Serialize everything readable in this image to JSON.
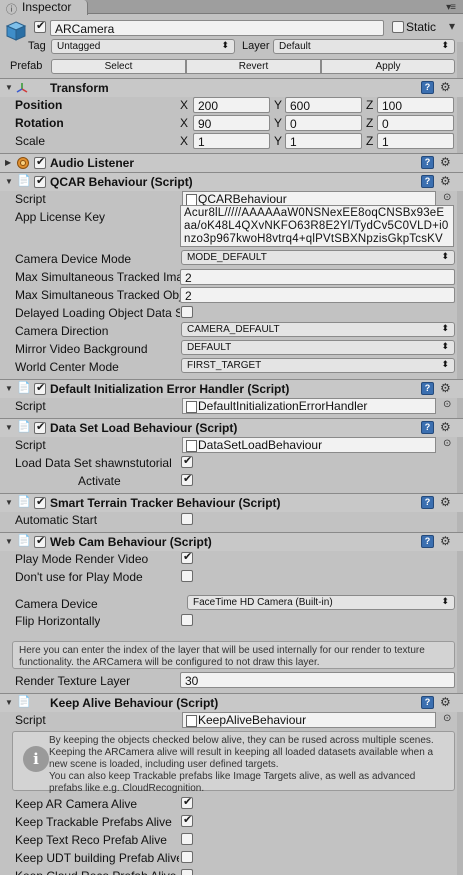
{
  "tab": {
    "label": "Inspector"
  },
  "header": {
    "object_name": "ARCamera",
    "static_label": "Static",
    "tag_label": "Tag",
    "tag_value": "Untagged",
    "layer_label": "Layer",
    "layer_value": "Default",
    "prefab_label": "Prefab",
    "select_label": "Select",
    "revert_label": "Revert",
    "apply_label": "Apply"
  },
  "transform": {
    "title": "Transform",
    "position_label": "Position",
    "rotation_label": "Rotation",
    "scale_label": "Scale",
    "axis_x": "X",
    "axis_y": "Y",
    "axis_z": "Z",
    "position": {
      "x": "200",
      "y": "600",
      "z": "100"
    },
    "rotation": {
      "x": "90",
      "y": "0",
      "z": "0"
    },
    "scale": {
      "x": "1",
      "y": "1",
      "z": "1"
    }
  },
  "audio": {
    "title": "Audio Listener"
  },
  "qcar": {
    "title": "QCAR Behaviour (Script)",
    "script_label": "Script",
    "script_value": "QCARBehaviour",
    "license_label": "App License Key",
    "license_value": "Acur8lL/////AAAAAaW0NSNexEE8oqCNSBx93eEaa/oK48L4QXvNKFO63R8E2Yl/TydCv5C0VLD+i0nzo3p967kwoH8vtrq4+qlPVtSBXNpzisGkpTcsKVRT",
    "camera_device_mode_label": "Camera Device Mode",
    "camera_device_mode_value": "MODE_DEFAULT",
    "max_images_label": "Max Simultaneous Tracked Ima",
    "max_images_value": "2",
    "max_objects_label": "Max Simultaneous Tracked Obj",
    "max_objects_value": "2",
    "delayed_label": "Delayed Loading Object Data Se",
    "camera_direction_label": "Camera Direction",
    "camera_direction_value": "CAMERA_DEFAULT",
    "mirror_label": "Mirror Video Background",
    "mirror_value": "DEFAULT",
    "world_center_label": "World Center Mode",
    "world_center_value": "FIRST_TARGET"
  },
  "init_error": {
    "title": "Default Initialization Error Handler (Script)",
    "script_label": "Script",
    "script_value": "DefaultInitializationErrorHandler"
  },
  "dataset": {
    "title": "Data Set Load Behaviour (Script)",
    "script_label": "Script",
    "script_value": "DataSetLoadBehaviour",
    "load_label": "Load Data Set shawnstutorial",
    "activate_label": "Activate"
  },
  "smart_terrain": {
    "title": "Smart Terrain Tracker Behaviour (Script)",
    "auto_start_label": "Automatic Start"
  },
  "webcam": {
    "title": "Web Cam Behaviour (Script)",
    "play_mode_label": "Play Mode Render Video",
    "dont_use_label": "Don't use for Play Mode",
    "camera_device_label": "Camera Device",
    "camera_device_value": "FaceTime HD Camera (Built-in)",
    "flip_label": "Flip Horizontally",
    "info_text": "Here you can enter the index of the layer that will be used internally for our render to texture functionality. the ARCamera will be configured to not draw this layer.",
    "render_layer_label": "Render Texture Layer",
    "render_layer_value": "30"
  },
  "keepalive": {
    "title": "Keep Alive Behaviour (Script)",
    "script_label": "Script",
    "script_value": "KeepAliveBehaviour",
    "info_line1": "By keeping the objects checked below alive, they can be rused across multiple scenes.",
    "info_line2": "Keeping the ARCamera alive will result in keeping all loaded datasets available when a new scene is loaded, including user defined targets.",
    "info_line3": "You can also keep Trackable prefabs like Image Targets alive, as well as advanced prefabs like e.g. CloudRecognition.",
    "keep_ar_label": "Keep AR Camera Alive",
    "keep_trackable_label": "Keep Trackable Prefabs Alive",
    "keep_text_label": "Keep Text Reco Prefab Alive",
    "keep_udt_label": "Keep UDT building Prefab Alive",
    "keep_cloud_label": "Keep Cloud Reco Prefab Alive"
  }
}
